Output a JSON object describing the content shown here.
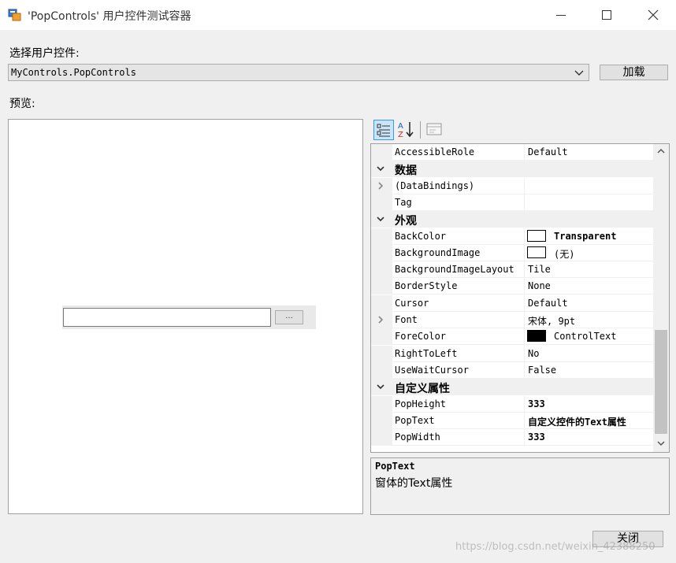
{
  "window": {
    "title": "'PopControls' 用户控件测试容器",
    "controls": [
      "minimize-icon",
      "maximize-icon",
      "close-icon"
    ]
  },
  "selector": {
    "label": "选择用户控件:",
    "value": "MyControls.PopControls",
    "load_button": "加载"
  },
  "preview": {
    "label": "预览:",
    "browse_button": "..."
  },
  "toolbar": {
    "buttons": [
      "categorized-icon",
      "alphabetical-sort-icon",
      "property-pages-icon"
    ]
  },
  "property_grid": {
    "rows": [
      {
        "type": "prop",
        "name": "AccessibleRole",
        "value": "Default"
      },
      {
        "type": "category",
        "name": "数据"
      },
      {
        "type": "prop",
        "name": "(DataBindings)",
        "value": "",
        "expandable": true
      },
      {
        "type": "prop",
        "name": "Tag",
        "value": ""
      },
      {
        "type": "category",
        "name": "外观"
      },
      {
        "type": "prop",
        "name": "BackColor",
        "value": "Transparent",
        "swatch": "#ffffff",
        "bold": true
      },
      {
        "type": "prop",
        "name": "BackgroundImage",
        "value": "(无)",
        "swatch": "#ffffff"
      },
      {
        "type": "prop",
        "name": "BackgroundImageLayout",
        "value": "Tile"
      },
      {
        "type": "prop",
        "name": "BorderStyle",
        "value": "None"
      },
      {
        "type": "prop",
        "name": "Cursor",
        "value": "Default"
      },
      {
        "type": "prop",
        "name": "Font",
        "value": "宋体, 9pt",
        "expandable": true
      },
      {
        "type": "prop",
        "name": "ForeColor",
        "value": "ControlText",
        "swatch": "#000000"
      },
      {
        "type": "prop",
        "name": "RightToLeft",
        "value": "No"
      },
      {
        "type": "prop",
        "name": "UseWaitCursor",
        "value": "False"
      },
      {
        "type": "category",
        "name": "自定义属性"
      },
      {
        "type": "prop",
        "name": "PopHeight",
        "value": "333",
        "bold": true
      },
      {
        "type": "prop",
        "name": "PopText",
        "value": "自定义控件的Text属性",
        "bold": true
      },
      {
        "type": "prop",
        "name": "PopWidth",
        "value": "333",
        "bold": true
      }
    ]
  },
  "description": {
    "title": "PopText",
    "text": "窗体的Text属性"
  },
  "footer": {
    "close_button": "关闭",
    "watermark": "https://blog.csdn.net/weixin_42388250"
  },
  "colors": {
    "window_bg": "#f0f0f0",
    "selected_tool": "#cce4f7",
    "accent": "#3399ff"
  }
}
